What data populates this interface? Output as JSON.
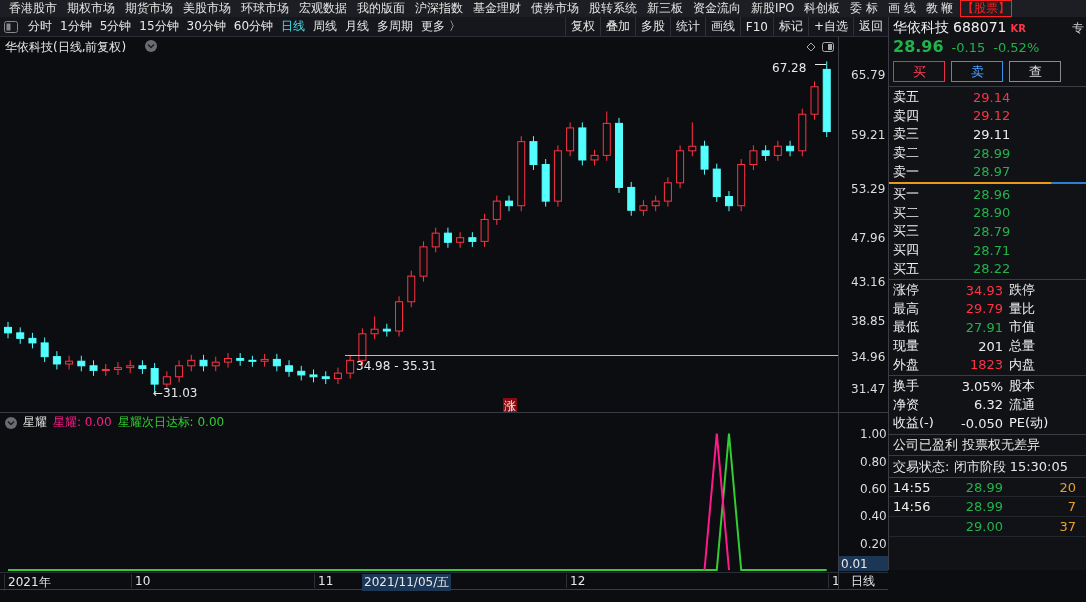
{
  "menu": {
    "items": [
      "香港股市",
      "期权市场",
      "期货市场",
      "美股市场",
      "环球市场",
      "宏观数据",
      "我的版面",
      "沪深指数",
      "基金理财",
      "债券市场",
      "股转系统",
      "新三板",
      "资金流向",
      "新股IPO",
      "科创板",
      "委 标",
      "画 线",
      "教 鞭"
    ],
    "tag": "【股票】"
  },
  "periods": [
    {
      "label": "分时",
      "selected": false
    },
    {
      "label": "1分钟",
      "selected": false
    },
    {
      "label": "5分钟",
      "selected": false
    },
    {
      "label": "15分钟",
      "selected": false
    },
    {
      "label": "30分钟",
      "selected": false
    },
    {
      "label": "60分钟",
      "selected": false
    },
    {
      "label": "日线",
      "selected": true
    },
    {
      "label": "周线",
      "selected": false
    },
    {
      "label": "月线",
      "selected": false
    },
    {
      "label": "多周期",
      "selected": false
    },
    {
      "label": "更多 〉",
      "selected": false
    }
  ],
  "tools": [
    "复权",
    "叠加",
    "多股",
    "统计",
    "画线",
    "F10",
    "标记",
    "+自选",
    "返回"
  ],
  "chart": {
    "title": "华依科技(日线,前复权)",
    "high_label": "67.28",
    "low_label": "←31.03",
    "range_label": "34.98 - 35.31",
    "badge": "涨",
    "chart_data": {
      "type": "candlestick",
      "ylim": [
        28.95,
        69.94
      ],
      "yticks": [
        65.79,
        59.21,
        53.29,
        47.96,
        43.16,
        38.85,
        34.96,
        31.47
      ],
      "ohlc": [
        [
          38.2,
          38.8,
          37.0,
          37.6
        ],
        [
          37.6,
          38.2,
          36.4,
          37.0
        ],
        [
          37.0,
          37.6,
          35.9,
          36.5
        ],
        [
          36.5,
          37.1,
          34.4,
          35.0
        ],
        [
          35.0,
          35.6,
          33.6,
          34.2
        ],
        [
          34.2,
          35.1,
          33.6,
          34.5
        ],
        [
          34.5,
          35.1,
          33.4,
          34.0
        ],
        [
          34.0,
          34.6,
          32.9,
          33.5
        ],
        [
          33.5,
          34.2,
          32.9,
          33.6
        ],
        [
          33.6,
          34.4,
          33.0,
          33.8
        ],
        [
          33.8,
          34.6,
          33.2,
          34.0
        ],
        [
          34.0,
          34.6,
          33.1,
          33.7
        ],
        [
          33.7,
          34.3,
          31.03,
          32.0
        ],
        [
          32.0,
          33.4,
          31.4,
          32.8
        ],
        [
          32.8,
          34.6,
          32.2,
          34.0
        ],
        [
          34.0,
          35.2,
          33.4,
          34.6
        ],
        [
          34.6,
          35.2,
          33.4,
          34.0
        ],
        [
          34.0,
          35.0,
          33.4,
          34.4
        ],
        [
          34.4,
          35.4,
          33.8,
          34.8
        ],
        [
          34.8,
          35.4,
          34.0,
          34.6
        ],
        [
          34.6,
          35.1,
          33.9,
          34.5
        ],
        [
          34.5,
          35.3,
          33.9,
          34.7
        ],
        [
          34.7,
          35.3,
          33.4,
          34.0
        ],
        [
          34.0,
          34.6,
          32.8,
          33.4
        ],
        [
          33.4,
          34.0,
          32.4,
          33.0
        ],
        [
          33.0,
          33.6,
          32.2,
          32.8
        ],
        [
          32.8,
          33.4,
          32.0,
          32.6
        ],
        [
          32.6,
          33.8,
          32.0,
          33.2
        ],
        [
          33.2,
          35.2,
          32.6,
          34.6
        ],
        [
          34.6,
          38.1,
          34.0,
          37.5
        ],
        [
          37.5,
          39.4,
          36.9,
          38.0
        ],
        [
          38.0,
          38.6,
          37.2,
          37.8
        ],
        [
          37.8,
          41.6,
          37.2,
          41.0
        ],
        [
          41.0,
          44.4,
          40.4,
          43.8
        ],
        [
          43.8,
          47.6,
          43.2,
          47.0
        ],
        [
          47.0,
          49.1,
          46.4,
          48.5
        ],
        [
          48.5,
          49.1,
          46.9,
          47.5
        ],
        [
          47.5,
          48.6,
          46.9,
          48.0
        ],
        [
          48.0,
          48.6,
          47.0,
          47.6
        ],
        [
          47.6,
          50.6,
          47.0,
          50.0
        ],
        [
          50.0,
          52.6,
          49.4,
          52.0
        ],
        [
          52.0,
          52.6,
          50.9,
          51.5
        ],
        [
          51.5,
          59.1,
          50.9,
          58.5
        ],
        [
          58.5,
          59.1,
          55.4,
          56.0
        ],
        [
          56.0,
          56.6,
          51.4,
          52.0
        ],
        [
          52.0,
          58.1,
          51.4,
          57.5
        ],
        [
          57.5,
          60.6,
          56.9,
          60.0
        ],
        [
          60.0,
          60.6,
          55.9,
          56.5
        ],
        [
          56.5,
          57.6,
          55.9,
          57.0
        ],
        [
          57.0,
          61.8,
          56.4,
          60.5
        ],
        [
          60.5,
          61.1,
          52.9,
          53.5
        ],
        [
          53.5,
          54.1,
          50.4,
          51.0
        ],
        [
          51.0,
          52.1,
          50.4,
          51.5
        ],
        [
          51.5,
          52.6,
          50.9,
          52.0
        ],
        [
          52.0,
          54.6,
          51.4,
          54.0
        ],
        [
          54.0,
          58.1,
          53.4,
          57.5
        ],
        [
          57.5,
          60.6,
          56.9,
          58.0
        ],
        [
          58.0,
          58.6,
          54.9,
          55.5
        ],
        [
          55.5,
          56.1,
          51.9,
          52.5
        ],
        [
          52.5,
          53.1,
          50.9,
          51.5
        ],
        [
          51.5,
          56.6,
          50.9,
          56.0
        ],
        [
          56.0,
          58.1,
          55.4,
          57.5
        ],
        [
          57.5,
          58.1,
          56.4,
          57.0
        ],
        [
          57.0,
          58.6,
          56.4,
          58.0
        ],
        [
          58.0,
          58.6,
          56.9,
          57.5
        ],
        [
          57.5,
          62.1,
          56.9,
          61.5
        ],
        [
          61.5,
          65.1,
          60.9,
          64.5
        ],
        [
          66.4,
          67.28,
          59.0,
          59.6
        ]
      ]
    }
  },
  "indicator": {
    "name": "星耀",
    "legend": [
      {
        "label": "星耀: 0.00",
        "color": "#ff1a8c"
      },
      {
        "label": "星耀次日达标: 0.00",
        "color": "#33cc33"
      }
    ],
    "readout": "0.01",
    "chart_data": {
      "type": "line",
      "yticks": [
        {
          "value": 1,
          "label": "1.00"
        },
        {
          "value": 0.8,
          "label": "0.80"
        },
        {
          "value": 0.6,
          "label": "0.60"
        },
        {
          "value": 0.4,
          "label": "0.40"
        },
        {
          "value": 0.2,
          "label": "0.20"
        }
      ],
      "ylim": [
        0,
        1.15
      ],
      "series": [
        {
          "color": "#33cc33",
          "values": [
            0,
            0,
            0,
            0,
            0,
            0,
            0,
            0,
            0,
            0,
            0,
            0,
            0,
            0,
            0,
            0,
            0,
            0,
            0,
            0,
            0,
            0,
            0,
            0,
            0,
            0,
            0,
            0,
            0,
            0,
            0,
            0,
            0,
            0,
            0,
            0,
            0,
            0,
            0,
            0,
            0,
            0,
            0,
            0,
            0,
            0,
            0,
            0,
            0,
            0,
            0,
            0,
            0,
            0,
            0,
            0,
            0,
            0,
            0,
            1,
            0,
            0,
            0,
            0,
            0,
            0,
            0,
            0
          ]
        },
        {
          "color": "#ff1a8c",
          "values": [
            null,
            null,
            null,
            null,
            null,
            null,
            null,
            null,
            null,
            null,
            null,
            null,
            null,
            null,
            null,
            null,
            null,
            null,
            null,
            null,
            null,
            null,
            null,
            null,
            null,
            null,
            null,
            null,
            null,
            null,
            null,
            null,
            null,
            null,
            null,
            null,
            null,
            null,
            null,
            null,
            null,
            null,
            null,
            null,
            null,
            null,
            null,
            null,
            null,
            null,
            null,
            null,
            null,
            null,
            null,
            null,
            null,
            0,
            1,
            0,
            null,
            null,
            null,
            null,
            null,
            null,
            null,
            null
          ]
        }
      ]
    }
  },
  "date_axis": {
    "labels": [
      "2021年",
      "10",
      "11",
      "12",
      "1"
    ],
    "cursor_date": "2021/11/05/五",
    "period": "日线"
  },
  "quote": {
    "name": "华依科技",
    "code": "688071",
    "tag": "KR",
    "extra": "专",
    "price": "28.96",
    "change": "-0.15",
    "change_pct": "-0.52%",
    "buttons": [
      {
        "label": "买",
        "kind": "buy"
      },
      {
        "label": "卖",
        "kind": "sell"
      },
      {
        "label": "查",
        "kind": "query"
      }
    ],
    "asks": [
      {
        "label": "卖五",
        "price": "29.14",
        "color": "#ff3344"
      },
      {
        "label": "卖四",
        "price": "29.12",
        "color": "#ff3344"
      },
      {
        "label": "卖三",
        "price": "29.11",
        "color": "#ececec"
      },
      {
        "label": "卖二",
        "price": "28.99",
        "color": "#22b24c"
      },
      {
        "label": "卖一",
        "price": "28.97",
        "color": "#22b24c"
      }
    ],
    "ratio_bar": {
      "level": 0.82
    },
    "bids": [
      {
        "label": "买一",
        "price": "28.96",
        "color": "#22b24c"
      },
      {
        "label": "买二",
        "price": "28.90",
        "color": "#22b24c"
      },
      {
        "label": "买三",
        "price": "28.79",
        "color": "#22b24c"
      },
      {
        "label": "买四",
        "price": "28.71",
        "color": "#22b24c"
      },
      {
        "label": "买五",
        "price": "28.22",
        "color": "#22b24c"
      }
    ],
    "stats": [
      {
        "label": "涨停",
        "value": "34.93",
        "color": "#ff3344",
        "label2": "跌停"
      },
      {
        "label": "最高",
        "value": "29.79",
        "color": "#ff3344",
        "label2": "量比"
      },
      {
        "label": "最低",
        "value": "27.91",
        "color": "#22b24c",
        "label2": "市值"
      },
      {
        "label": "现量",
        "value": "201",
        "color": "#ececec",
        "label2": "总量"
      },
      {
        "label": "外盘",
        "value": "1823",
        "color": "#ff3344",
        "label2": "内盘"
      }
    ],
    "stats2": [
      {
        "label": "换手",
        "value": "3.05%",
        "label2": "股本"
      },
      {
        "label": "净资",
        "value": "6.32",
        "label2": "流通"
      },
      {
        "label": "收益(-)",
        "value": "-0.050",
        "label2": "PE(动)"
      }
    ],
    "notice": "公司已盈利 投票权无差异",
    "status": "交易状态: 闭市阶段 15:30:05",
    "trades": [
      {
        "time": "14:55",
        "price": "28.99",
        "volume": "20"
      },
      {
        "time": "14:56",
        "price": "28.99",
        "volume": "7"
      },
      {
        "price": "29.00",
        "volume": "37"
      }
    ]
  }
}
